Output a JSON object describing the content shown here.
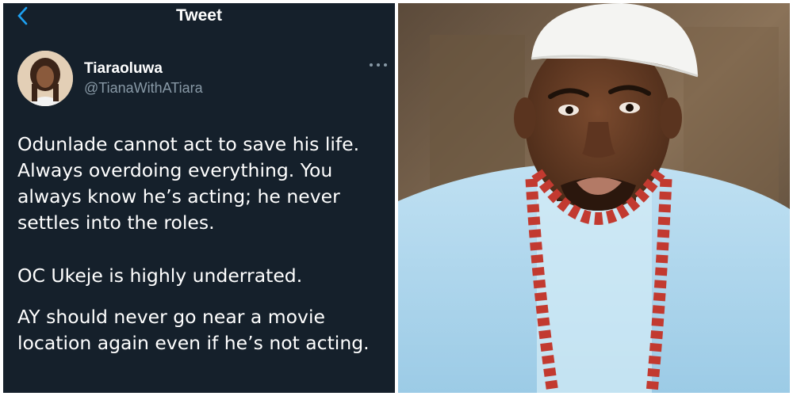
{
  "header": {
    "title": "Tweet",
    "back_icon": "chevron-left-icon"
  },
  "user": {
    "name": "Tiaraoluwa",
    "handle": "@TianaWithATiara"
  },
  "tweet": {
    "paragraph1": [
      "Odunlade cannot act to save his life.",
      "Always overdoing everything. You",
      "always know he’s acting; he never",
      "settles into the roles."
    ],
    "paragraph2": "OC Ukeje is highly underrated.",
    "paragraph3": [
      "AY should never go near a movie",
      "location again even if he’s not acting."
    ]
  },
  "colors": {
    "background": "#15202b",
    "accent": "#1da1f2",
    "secondary_text": "#8899a6"
  }
}
